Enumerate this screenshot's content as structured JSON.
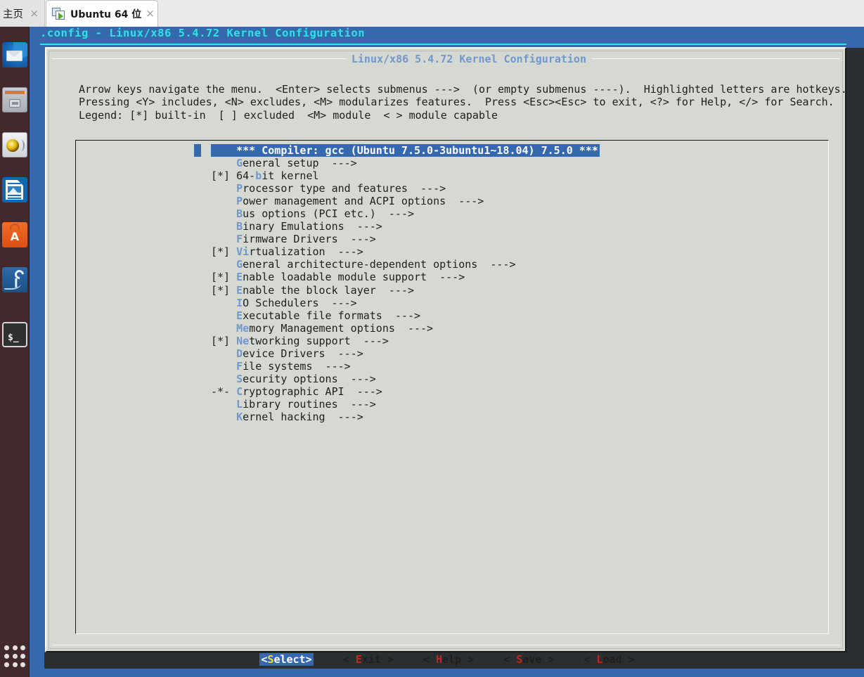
{
  "window": {
    "tabs": [
      {
        "label": "主页",
        "active": false,
        "close": "×",
        "icon": "none"
      },
      {
        "label": "Ubuntu 64 位",
        "active": true,
        "close": "×",
        "icon": "vmware-vm-icon"
      }
    ]
  },
  "launcher": {
    "items": [
      {
        "name": "thunderbird-icon",
        "label": "Thunderbird Mail"
      },
      {
        "name": "files-icon",
        "label": "Files"
      },
      {
        "name": "rhythmbox-icon",
        "label": "Rhythmbox"
      },
      {
        "name": "libreoffice-writer-icon",
        "label": "LibreOffice Writer"
      },
      {
        "name": "ubuntu-software-icon",
        "label": "Ubuntu Software"
      },
      {
        "name": "system-tools-icon",
        "label": "System Tools"
      },
      {
        "name": "terminal-icon",
        "label": "Terminal"
      }
    ],
    "app_grid": "show-applications-icon",
    "terminal_prompt": "$_",
    "software_letter": "A"
  },
  "menuconfig": {
    "window_title": ".config - Linux/x86 5.4.72 Kernel Configuration",
    "dialog_caption": "Linux/x86 5.4.72 Kernel Configuration",
    "help_lines": [
      "Arrow keys navigate the menu.  <Enter> selects submenus --->  (or empty submenus ----).  Highlighted letters are hotkeys.",
      "Pressing <Y> includes, <N> excludes, <M> modularizes features.  Press <Esc><Esc> to exit, <?> for Help, </> for Search.",
      "Legend: [*] built-in  [ ] excluded  <M> module  < > module capable"
    ],
    "menu_items": [
      {
        "flag": "",
        "hot": "",
        "pre": "",
        "text": "*** Compiler: gcc (Ubuntu 7.5.0-3ubuntu1~18.04) 7.5.0 ***",
        "arrow": "",
        "selected": true
      },
      {
        "flag": "",
        "hot": "G",
        "pre": "",
        "text": "eneral setup",
        "arrow": "  --->",
        "selected": false
      },
      {
        "flag": "[*]",
        "hot": "b",
        "pre": "64-",
        "text": "it kernel",
        "arrow": "",
        "selected": false
      },
      {
        "flag": "",
        "hot": "P",
        "pre": "",
        "text": "rocessor type and features",
        "arrow": "  --->",
        "selected": false
      },
      {
        "flag": "",
        "hot": "P",
        "pre": "",
        "text": "ower management and ACPI options",
        "arrow": "  --->",
        "selected": false
      },
      {
        "flag": "",
        "hot": "B",
        "pre": "",
        "text": "us options (PCI etc.)",
        "arrow": "  --->",
        "selected": false
      },
      {
        "flag": "",
        "hot": "B",
        "pre": "",
        "text": "inary Emulations",
        "arrow": "  --->",
        "selected": false
      },
      {
        "flag": "",
        "hot": "F",
        "pre": "",
        "text": "irmware Drivers",
        "arrow": "  --->",
        "selected": false
      },
      {
        "flag": "[*]",
        "hot": "Vi",
        "pre": "",
        "text": "rtualization",
        "arrow": "  --->",
        "selected": false
      },
      {
        "flag": "",
        "hot": "G",
        "pre": "",
        "text": "eneral architecture-dependent options",
        "arrow": "  --->",
        "selected": false
      },
      {
        "flag": "[*]",
        "hot": "E",
        "pre": "",
        "text": "nable loadable module support",
        "arrow": "  --->",
        "selected": false
      },
      {
        "flag": "[*]",
        "hot": "E",
        "pre": "",
        "text": "nable the block layer",
        "arrow": "  --->",
        "selected": false
      },
      {
        "flag": "",
        "hot": "I",
        "pre": "",
        "text": "O Schedulers",
        "arrow": "  --->",
        "selected": false
      },
      {
        "flag": "",
        "hot": "E",
        "pre": "",
        "text": "xecutable file formats",
        "arrow": "  --->",
        "selected": false
      },
      {
        "flag": "",
        "hot": "Me",
        "pre": "",
        "text": "mory Management options",
        "arrow": "  --->",
        "selected": false
      },
      {
        "flag": "[*]",
        "hot": "Ne",
        "pre": "",
        "text": "tworking support",
        "arrow": "  --->",
        "selected": false
      },
      {
        "flag": "",
        "hot": "D",
        "pre": "",
        "text": "evice Drivers",
        "arrow": "  --->",
        "selected": false
      },
      {
        "flag": "",
        "hot": "F",
        "pre": "",
        "text": "ile systems",
        "arrow": "  --->",
        "selected": false
      },
      {
        "flag": "",
        "hot": "S",
        "pre": "",
        "text": "ecurity options",
        "arrow": "  --->",
        "selected": false
      },
      {
        "flag": "-*-",
        "hot": "C",
        "pre": "",
        "text": "ryptographic API",
        "arrow": "  --->",
        "selected": false
      },
      {
        "flag": "",
        "hot": "L",
        "pre": "",
        "text": "ibrary routines",
        "arrow": "  --->",
        "selected": false
      },
      {
        "flag": "",
        "hot": "K",
        "pre": "",
        "text": "ernel hacking",
        "arrow": "  --->",
        "selected": false
      }
    ],
    "buttons": [
      {
        "open": "<",
        "hot": "S",
        "rest": "elect",
        "close": ">",
        "selected": true
      },
      {
        "open": "< ",
        "hot": "E",
        "rest": "xit",
        "close": " >",
        "selected": false
      },
      {
        "open": "< ",
        "hot": "H",
        "rest": "elp",
        "close": " >",
        "selected": false
      },
      {
        "open": "< ",
        "hot": "S",
        "rest": "ave",
        "close": " >",
        "selected": false
      },
      {
        "open": "< ",
        "hot": "L",
        "rest": "oad",
        "close": " >",
        "selected": false
      }
    ]
  },
  "colors": {
    "terminal_blue": "#3668ae",
    "cyan_title": "#2fe3e3",
    "dialog_bg": "#d5d9d2",
    "hotkey_blue": "#6f97d0",
    "button_hotkey_red": "#c0261d",
    "button_hotkey_yellow": "#f3e02c",
    "launcher_bg": "#43282c"
  }
}
